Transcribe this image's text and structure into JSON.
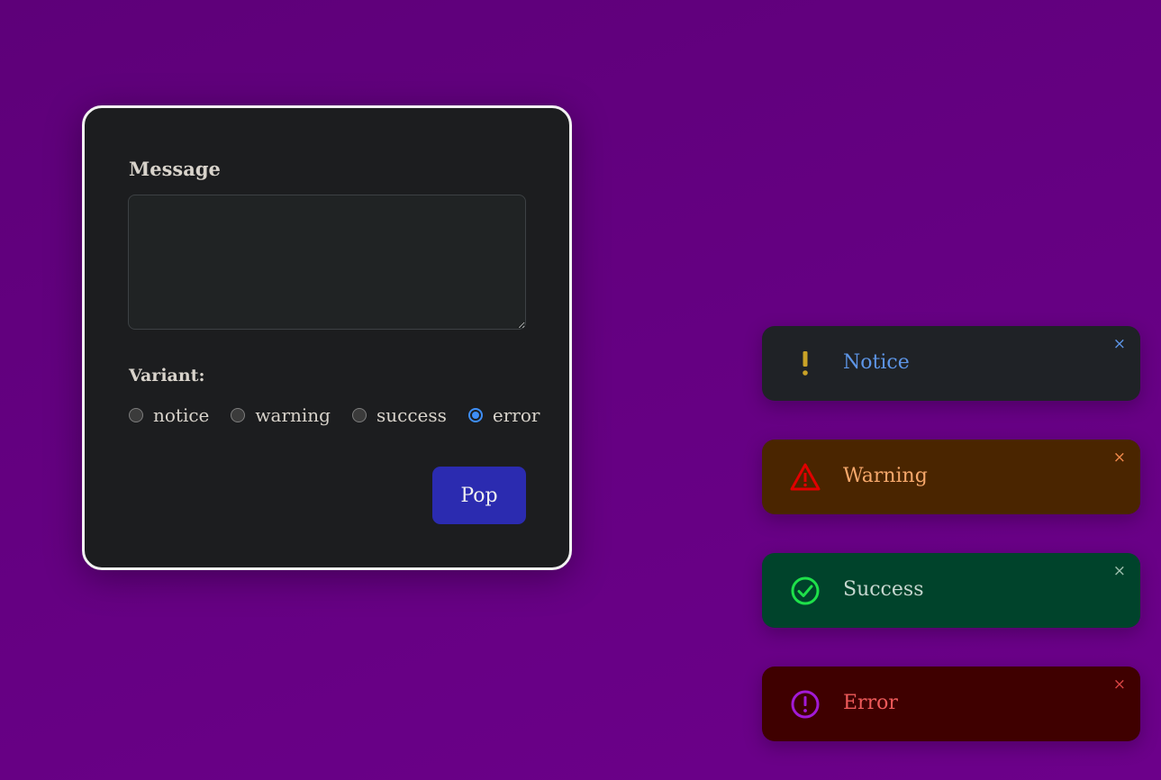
{
  "form": {
    "message_label": "Message",
    "message_value": "",
    "variant_label": "Variant:",
    "variants": [
      {
        "label": "notice",
        "checked": false
      },
      {
        "label": "warning",
        "checked": false
      },
      {
        "label": "success",
        "checked": false
      },
      {
        "label": "error",
        "checked": true
      }
    ],
    "pop_label": "Pop"
  },
  "toasts": [
    {
      "variant": "notice",
      "title": "Notice",
      "close": "×",
      "icon": "exclamation-icon",
      "icon_color": "#c9a227"
    },
    {
      "variant": "warning",
      "title": "Warning",
      "close": "×",
      "icon": "warning-triangle-icon",
      "icon_color": "#e00000"
    },
    {
      "variant": "success",
      "title": "Success",
      "close": "×",
      "icon": "check-circle-icon",
      "icon_color": "#1ee04a"
    },
    {
      "variant": "error",
      "title": "Error",
      "close": "×",
      "icon": "error-circle-icon",
      "icon_color": "#a21ad6"
    }
  ],
  "colors": {
    "background": "#650082",
    "panel": "#1c1d1f",
    "accent": "#3e8ef7",
    "button": "#2b2bb0"
  }
}
